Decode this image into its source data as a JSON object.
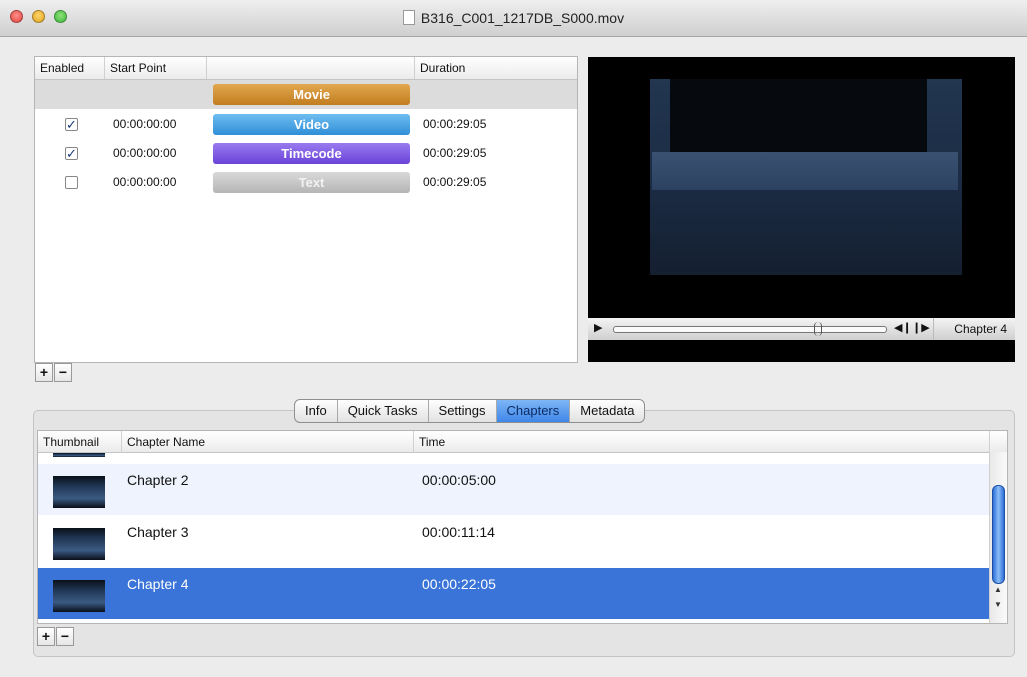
{
  "window": {
    "title": "B316_C001_1217DB_S000.mov"
  },
  "tracks": {
    "headers": {
      "enabled": "Enabled",
      "start_point": "Start Point",
      "name": "",
      "duration": "Duration"
    },
    "rows": [
      {
        "enabled": null,
        "start": "",
        "name": "Movie",
        "duration": ""
      },
      {
        "enabled": true,
        "start": "00:00:00:00",
        "name": "Video",
        "duration": "00:00:29:05"
      },
      {
        "enabled": true,
        "start": "00:00:00:00",
        "name": "Timecode",
        "duration": "00:00:29:05"
      },
      {
        "enabled": false,
        "start": "00:00:00:00",
        "name": "Text",
        "duration": "00:00:29:05"
      }
    ],
    "add_label": "+",
    "remove_label": "−"
  },
  "player": {
    "chapter_label": "Chapter 4",
    "play_glyph": "▶",
    "step_back_glyph": "◀❙",
    "step_forward_glyph": "❙▶"
  },
  "tabs": [
    "Info",
    "Quick Tasks",
    "Settings",
    "Chapters",
    "Metadata"
  ],
  "active_tab": "Chapters",
  "chapters": {
    "headers": {
      "thumbnail": "Thumbnail",
      "name": "Chapter Name",
      "time": "Time"
    },
    "rows": [
      {
        "name": "Chapter 2",
        "time": "00:00:05:00",
        "selected": false
      },
      {
        "name": "Chapter 3",
        "time": "00:00:11:14",
        "selected": false
      },
      {
        "name": "Chapter 4",
        "time": "00:00:22:05",
        "selected": true
      }
    ],
    "add_label": "+",
    "remove_label": "−"
  },
  "colors": {
    "selection": "#3a74d8",
    "movie_pill": "#d08f32",
    "video_pill": "#4ea6e6",
    "timecode_pill": "#7f5ee6",
    "text_pill": "#c5c5c5",
    "active_tab": "#5a9cf0"
  }
}
